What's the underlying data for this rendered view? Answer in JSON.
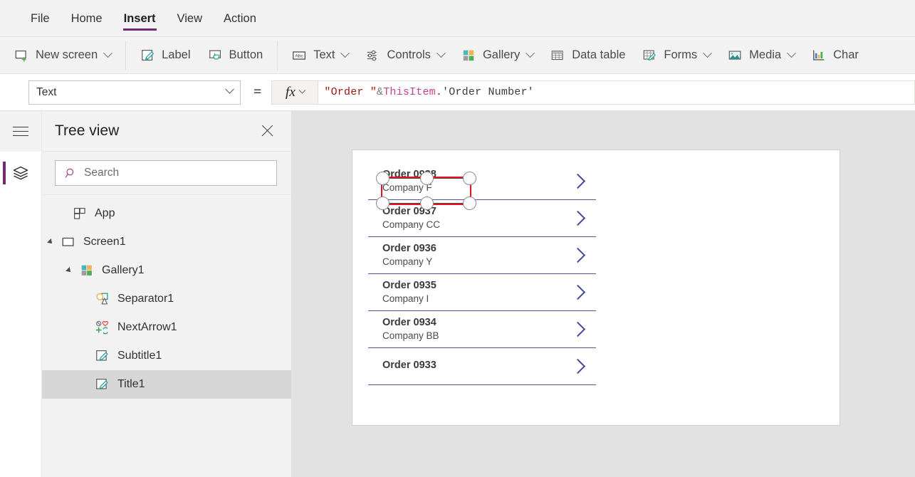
{
  "menu": {
    "items": [
      {
        "label": "File",
        "active": false
      },
      {
        "label": "Home",
        "active": false
      },
      {
        "label": "Insert",
        "active": true
      },
      {
        "label": "View",
        "active": false
      },
      {
        "label": "Action",
        "active": false
      }
    ]
  },
  "ribbon": {
    "groups": [
      [
        {
          "label": "New screen",
          "icon": "new-screen-icon",
          "caret": true
        }
      ],
      [
        {
          "label": "Label",
          "icon": "label-icon",
          "caret": false
        },
        {
          "label": "Button",
          "icon": "button-icon",
          "caret": false
        }
      ],
      [
        {
          "label": "Text",
          "icon": "text-icon",
          "caret": true
        },
        {
          "label": "Controls",
          "icon": "controls-icon",
          "caret": true
        },
        {
          "label": "Gallery",
          "icon": "gallery-icon",
          "caret": true
        },
        {
          "label": "Data table",
          "icon": "data-table-icon",
          "caret": false
        },
        {
          "label": "Forms",
          "icon": "forms-icon",
          "caret": true
        },
        {
          "label": "Media",
          "icon": "media-icon",
          "caret": true
        },
        {
          "label": "Char",
          "icon": "charts-icon",
          "caret": false
        }
      ]
    ]
  },
  "formula_bar": {
    "property": "Text",
    "equals": "=",
    "fx_label": "fx",
    "formula_tokens": [
      {
        "text": "\"Order \"",
        "kind": "str"
      },
      {
        "text": " & ",
        "kind": "op"
      },
      {
        "text": "ThisItem",
        "kind": "obj"
      },
      {
        "text": ".'Order Number'",
        "kind": "def"
      }
    ],
    "formula_plain": "\"Order \" & ThisItem.'Order Number'"
  },
  "rail": {
    "hamburger": "hamburger-icon",
    "active_button": "tree-view-layers-icon"
  },
  "tree_panel": {
    "title": "Tree view",
    "close_label": "close-icon",
    "search": {
      "placeholder": "Search"
    },
    "items": [
      {
        "label": "App",
        "icon": "app-icon",
        "indent": 0,
        "twisty": "none",
        "selected": false
      },
      {
        "label": "Screen1",
        "icon": "screen-icon",
        "indent": 0,
        "twisty": "expanded",
        "selected": false
      },
      {
        "label": "Gallery1",
        "icon": "gallery-icon",
        "indent": 1,
        "twisty": "expanded",
        "selected": false
      },
      {
        "label": "Separator1",
        "icon": "shapes-icon",
        "indent": 2,
        "twisty": "none",
        "selected": false
      },
      {
        "label": "NextArrow1",
        "icon": "icons-icon",
        "indent": 2,
        "twisty": "none",
        "selected": false
      },
      {
        "label": "Subtitle1",
        "icon": "label-icon",
        "indent": 2,
        "twisty": "none",
        "selected": false
      },
      {
        "label": "Title1",
        "icon": "label-icon",
        "indent": 2,
        "twisty": "none",
        "selected": true
      }
    ]
  },
  "canvas": {
    "gallery_items": [
      {
        "title": "Order 0938",
        "subtitle": "Company F",
        "selected": true,
        "clipped": false
      },
      {
        "title": "Order 0937",
        "subtitle": "Company CC",
        "selected": false,
        "clipped": false
      },
      {
        "title": "Order 0936",
        "subtitle": "Company Y",
        "selected": false,
        "clipped": false
      },
      {
        "title": "Order 0935",
        "subtitle": "Company I",
        "selected": false,
        "clipped": false
      },
      {
        "title": "Order 0934",
        "subtitle": "Company BB",
        "selected": false,
        "clipped": false
      },
      {
        "title": "Order 0933",
        "subtitle": "",
        "selected": false,
        "clipped": true
      }
    ]
  },
  "colors": {
    "accent_purple": "#742774",
    "selection_red": "#e81123",
    "gallery_arrow": "#414a93",
    "separator": "#4c5698",
    "canvas_backdrop": "#e1e1e1"
  }
}
